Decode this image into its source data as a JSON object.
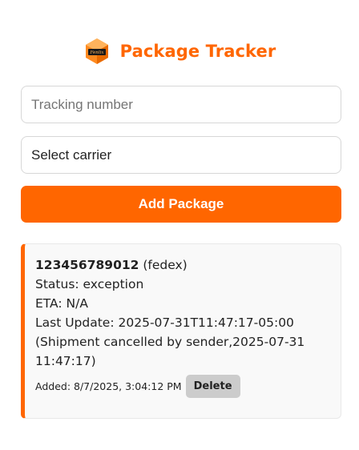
{
  "header": {
    "logo_text": "Fenlix",
    "title": "Package Tracker"
  },
  "form": {
    "tracking_placeholder": "Tracking number",
    "tracking_value": "",
    "carrier_selected": "Select carrier",
    "add_button_label": "Add Package"
  },
  "colors": {
    "brand": "#ff6600",
    "delete_button": "#cccccc"
  },
  "packages": [
    {
      "tracking_number": "123456789012",
      "carrier": "(fedex)",
      "status": "Status: exception",
      "eta": "ETA: N/A",
      "last_update": "Last Update: 2025-07-31T11:47:17-05:00",
      "detail": "(Shipment cancelled by sender,2025-07-31 11:47:17)",
      "added": "Added: 8/7/2025, 3:04:12 PM",
      "delete_label": "Delete"
    }
  ]
}
